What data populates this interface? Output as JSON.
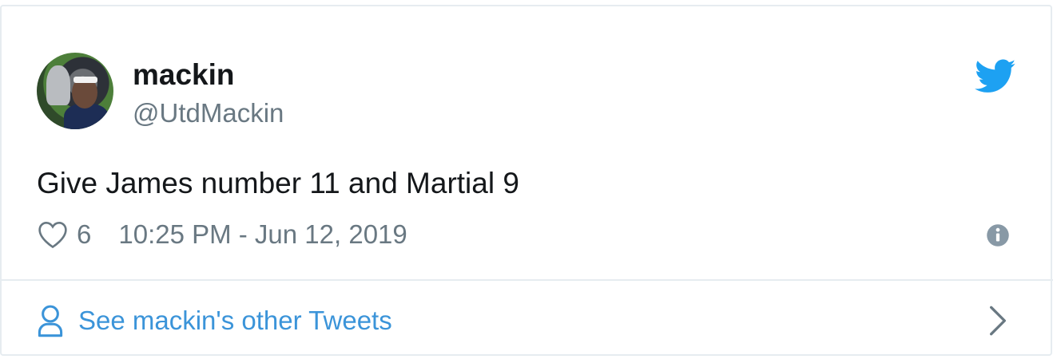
{
  "author": {
    "name": "mackin",
    "handle": "@UtdMackin"
  },
  "tweet": {
    "text": "Give James number 11 and Martial 9",
    "likes": "6",
    "timestamp": "10:25 PM - Jun 12, 2019"
  },
  "footer": {
    "link_label": "See mackin's other Tweets"
  },
  "icons": {
    "brand": "twitter-bird-icon",
    "like": "heart-icon",
    "info": "info-icon",
    "profile": "person-icon",
    "next": "chevron-right-icon"
  },
  "colors": {
    "brand_blue": "#1da1f2",
    "link_blue": "#3b94d9",
    "text_primary": "#14171a",
    "text_secondary": "#697882",
    "border": "#e6ecf0"
  }
}
